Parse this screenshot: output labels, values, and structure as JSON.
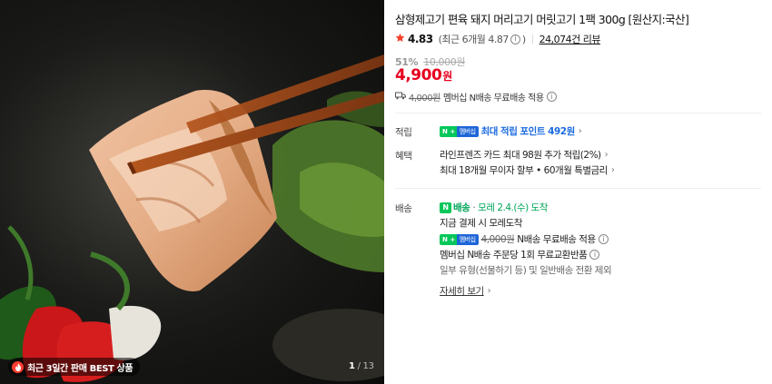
{
  "gallery": {
    "badge_text": "최근 3일간 판매 BEST 상품",
    "counter_current": "1",
    "counter_separator": "/",
    "counter_total": "13"
  },
  "product": {
    "title": "삼형제고기 편육 돼지 머리고기 머릿고기 1팩 300g [원산지:국산]",
    "rating": "4.83",
    "recent_rating_text": "(최근 6개월 4.87",
    "recent_rating_close": ")",
    "review_count_text": "24,074건 리뷰",
    "discount_rate": "51%",
    "original_price": "10,000원",
    "price": "4,900",
    "price_unit": "원",
    "membership_shipping": {
      "strike_price": "4,000원",
      "text": "멤버십 N배송 무료배송 적용"
    }
  },
  "points": {
    "label": "적립",
    "badge_n": "N",
    "badge_plus": "+",
    "badge_member": "멤버십",
    "text": "최대 적립 포인트 492원"
  },
  "benefit": {
    "label": "혜택",
    "line1": "라인프렌즈 카드 최대 98원 추가 적립(2%)",
    "line2": "최대 18개월 무이자 할부 • 60개월 특별금리"
  },
  "delivery": {
    "label": "배송",
    "logo_text": "배송",
    "dot": "·",
    "arrival": "모레 2.4.(수) 도착",
    "order_note": "지금 결제 시 모레도착",
    "strike_price": "4,000원",
    "free_text": "N배송 무료배송 적용",
    "return_text": "멤버십 N배송 주문당 1회 무료교환반품",
    "exclude_text": "일부 유형(선물하기 등) 및 일반배송 전환 제외",
    "more_link": "자세히 보기"
  },
  "icons": {
    "star": "star-icon",
    "info": "info-icon",
    "truck": "truck-icon",
    "chevron": "chevron-right-icon"
  },
  "colors": {
    "price_red": "#e6001e",
    "star_red": "#f5402c",
    "naver_green": "#03c75a",
    "point_blue": "#1b6ae0"
  }
}
